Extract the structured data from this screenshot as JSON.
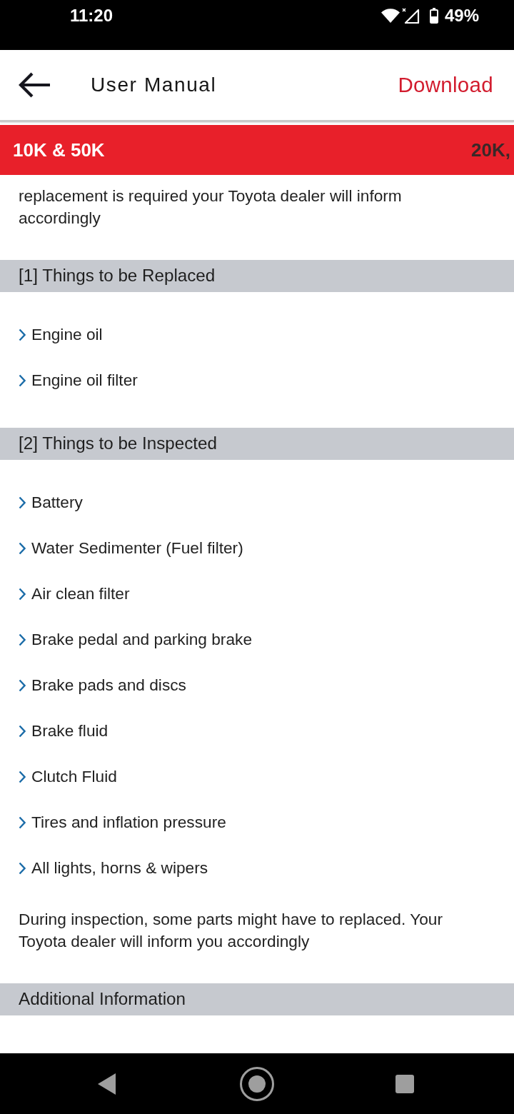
{
  "status_bar": {
    "time": "11:20",
    "battery": "49%"
  },
  "header": {
    "title": "User Manual",
    "action": "Download"
  },
  "tabs": [
    {
      "label": "10K & 50K",
      "selected": true
    },
    {
      "label": "20K,",
      "selected": false
    }
  ],
  "blocks": [
    {
      "kind": "text",
      "text": "replacement is required your Toyota dealer will inform accordingly"
    },
    {
      "kind": "heading",
      "text": "[1] Things to be Replaced"
    },
    {
      "kind": "list",
      "items": [
        "Engine oil",
        "Engine oil filter"
      ]
    },
    {
      "kind": "heading",
      "text": "[2] Things to be Inspected"
    },
    {
      "kind": "list",
      "items": [
        "Battery",
        "Water Sedimenter (Fuel filter)",
        "Air clean filter",
        "Brake pedal and parking brake",
        "Brake pads and discs",
        "Brake fluid",
        "Clutch Fluid",
        "Tires and inflation pressure",
        "All lights, horns & wipers"
      ]
    },
    {
      "kind": "text",
      "text": "During inspection, some parts might have to replaced. Your Toyota dealer will inform you accordingly"
    },
    {
      "kind": "heading",
      "text": "Additional Information"
    }
  ]
}
